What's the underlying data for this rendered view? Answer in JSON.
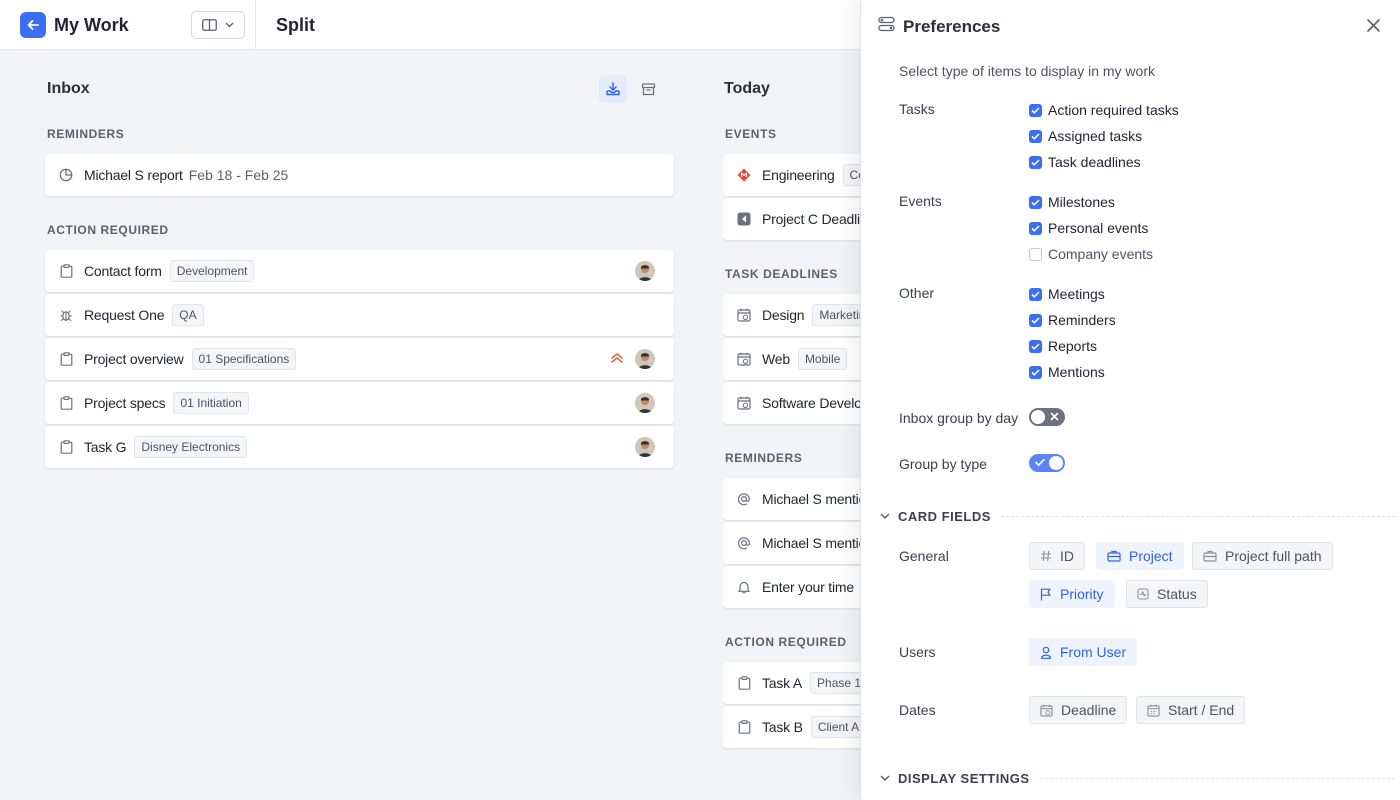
{
  "header": {
    "app_title": "My Work",
    "view_title": "Split"
  },
  "inbox": {
    "title": "Inbox",
    "reminders_label": "REMINDERS",
    "reminders": [
      {
        "title": "Michael S report",
        "sub": "Feb 18 - Feb 25",
        "icon": "pie-chart-icon"
      }
    ],
    "action_label": "ACTION REQUIRED",
    "action_items": [
      {
        "title": "Contact form",
        "tag": "Development",
        "icon": "clipboard-icon",
        "avatar": true,
        "priority": false
      },
      {
        "title": "Request One",
        "tag": "QA",
        "icon": "bug-icon",
        "avatar": false,
        "priority": false
      },
      {
        "title": "Project overview",
        "tag": "01 Specifications",
        "icon": "clipboard-icon",
        "avatar": true,
        "priority": true
      },
      {
        "title": "Project specs",
        "tag": "01 Initiation",
        "icon": "clipboard-icon",
        "avatar": true,
        "priority": false
      },
      {
        "title": "Task G",
        "tag": "Disney Electronics",
        "icon": "clipboard-icon",
        "avatar": true,
        "priority": false
      }
    ]
  },
  "today": {
    "title": "Today",
    "events_label": "EVENTS",
    "events": [
      {
        "title": "Engineering",
        "tag": "Co"
      },
      {
        "title": "Project C Deadlin",
        "tag": ""
      }
    ],
    "deadlines_label": "TASK DEADLINES",
    "deadlines": [
      {
        "title": "Design",
        "tag": "Marketin"
      },
      {
        "title": "Web",
        "tag": "Mobile"
      },
      {
        "title": "Software Develop",
        "tag": ""
      }
    ],
    "reminders_label": "REMINDERS",
    "reminders": [
      {
        "title": "Michael S mentio"
      },
      {
        "title": "Michael S mentio"
      },
      {
        "title": "Enter your time"
      }
    ],
    "action_label": "ACTION REQUIRED",
    "action_items": [
      {
        "title": "Task A",
        "tag": "Phase 1"
      },
      {
        "title": "Task B",
        "tag": "Client A"
      }
    ]
  },
  "preferences": {
    "title": "Preferences",
    "description": "Select type of items to display in my work",
    "tasks_label": "Tasks",
    "tasks": [
      {
        "label": "Action required tasks",
        "checked": true
      },
      {
        "label": "Assigned tasks",
        "checked": true
      },
      {
        "label": "Task deadlines",
        "checked": true
      }
    ],
    "events_label": "Events",
    "events": [
      {
        "label": "Milestones",
        "checked": true
      },
      {
        "label": "Personal events",
        "checked": true
      },
      {
        "label": "Company events",
        "checked": false
      }
    ],
    "other_label": "Other",
    "other": [
      {
        "label": "Meetings",
        "checked": true
      },
      {
        "label": "Reminders",
        "checked": true
      },
      {
        "label": "Reports",
        "checked": true
      },
      {
        "label": "Mentions",
        "checked": true
      }
    ],
    "inbox_group_label": "Inbox group by day",
    "inbox_group_on": false,
    "group_type_label": "Group by type",
    "group_type_on": true,
    "card_fields_label": "CARD FIELDS",
    "general_label": "General",
    "general_chips": [
      {
        "label": "ID",
        "active": false,
        "icon": "hash-icon"
      },
      {
        "label": "Project",
        "active": true,
        "icon": "briefcase-icon"
      },
      {
        "label": "Project full path",
        "active": false,
        "icon": "briefcase-icon"
      },
      {
        "label": "Priority",
        "active": true,
        "icon": "flag-icon"
      },
      {
        "label": "Status",
        "active": false,
        "icon": "status-icon"
      }
    ],
    "users_label": "Users",
    "users_chips": [
      {
        "label": "From User",
        "active": true,
        "icon": "user-icon"
      }
    ],
    "dates_label": "Dates",
    "dates_chips": [
      {
        "label": "Deadline",
        "active": false,
        "icon": "calendar-clock-icon"
      },
      {
        "label": "Start / End",
        "active": false,
        "icon": "calendar-icon"
      }
    ],
    "display_settings_label": "DISPLAY SETTINGS"
  },
  "colors": {
    "accent": "#3b6ef5",
    "priority": "#e8643c"
  }
}
